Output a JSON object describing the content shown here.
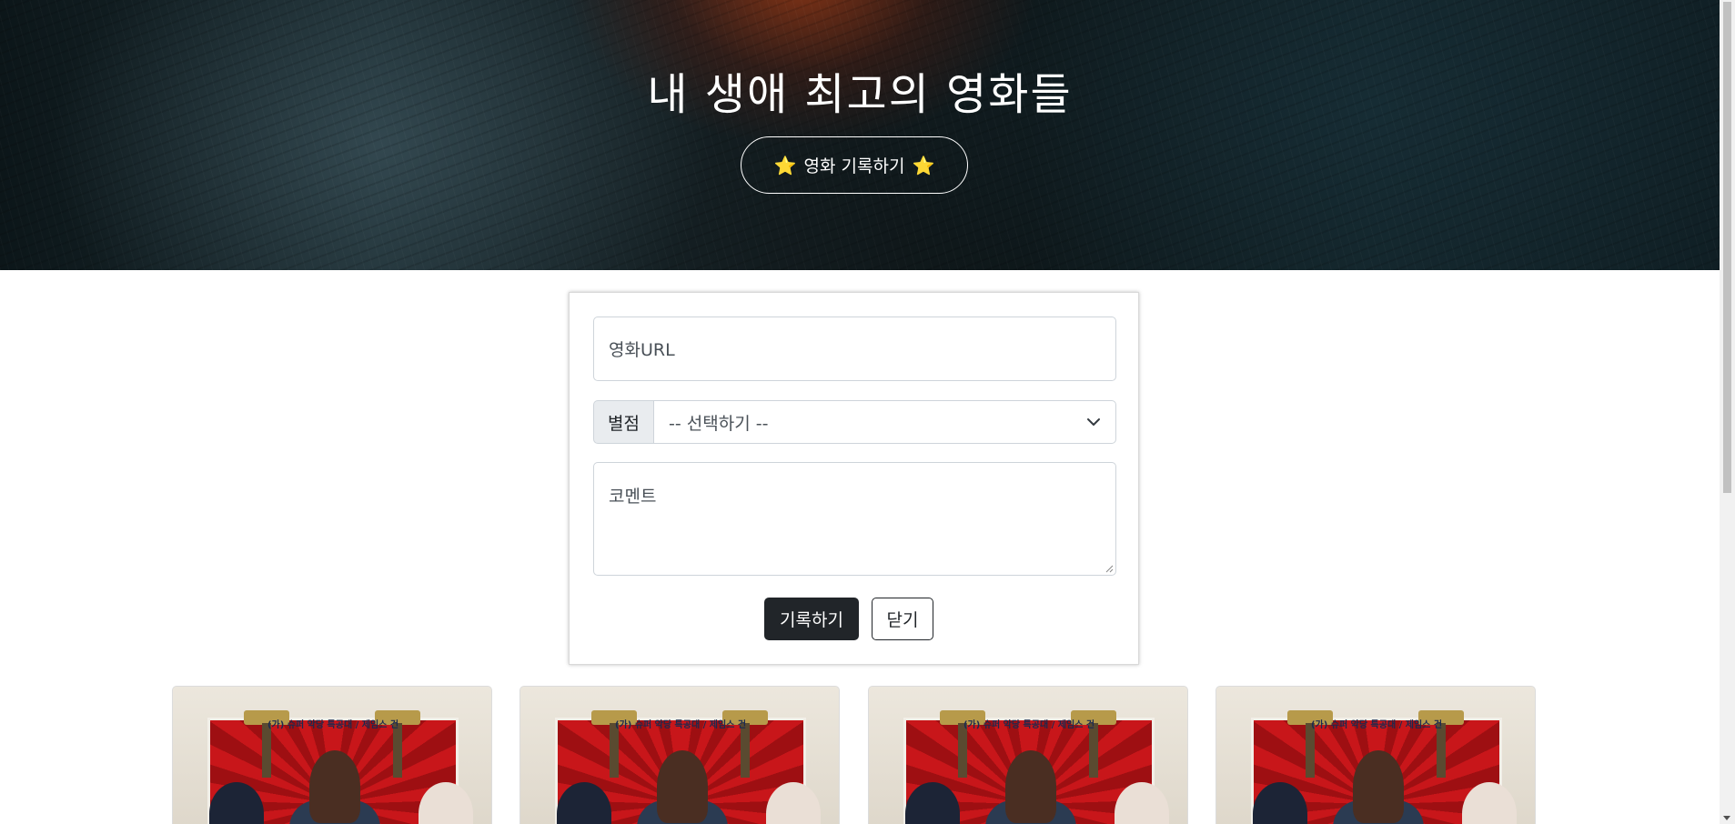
{
  "hero": {
    "title": "내 생애 최고의 영화들",
    "button_label": "영화 기록하기",
    "star_icon": "⭐"
  },
  "form": {
    "url_placeholder": "영화URL",
    "star_label": "별점",
    "star_select_value": "-- 선택하기 --",
    "comment_placeholder": "코멘트",
    "save_label": "기록하기",
    "close_label": "닫기"
  },
  "cards": [
    {
      "poster_title": "(가) 슈퍼 악당 특공대 / 제임스 건",
      "poster_subtitle": "제임스 건"
    },
    {
      "poster_title": "(가) 슈퍼 악당 특공대 / 제임스 건",
      "poster_subtitle": "제임스 건"
    },
    {
      "poster_title": "(가) 슈퍼 악당 특공대 / 제임스 건",
      "poster_subtitle": "제임스 건"
    },
    {
      "poster_title": "(가) 슈퍼 악당 특공대 / 제임스 건",
      "poster_subtitle": "제임스 건"
    }
  ],
  "colors": {
    "accent_dark": "#212529",
    "star_color": "#f5c518",
    "border": "#ced4da"
  }
}
